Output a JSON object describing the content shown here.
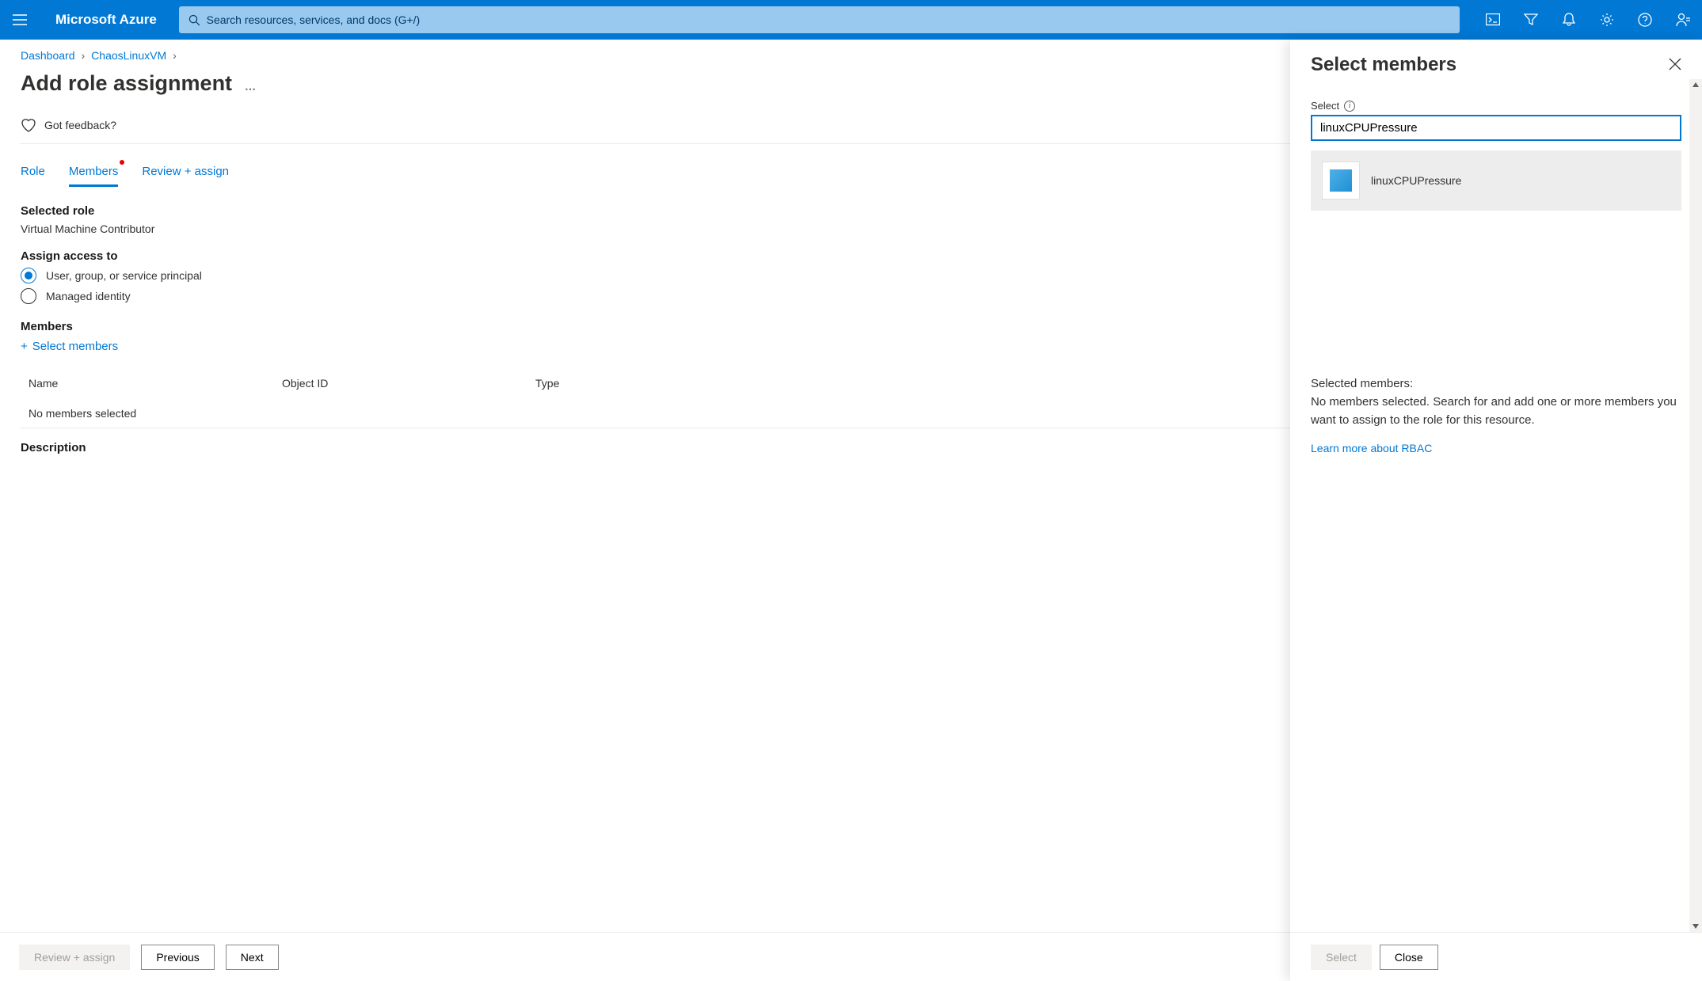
{
  "brand": "Microsoft Azure",
  "search_placeholder": "Search resources, services, and docs (G+/)",
  "breadcrumb": {
    "item0": "Dashboard",
    "item1": "ChaosLinuxVM"
  },
  "page_title": "Add role assignment",
  "feedback": "Got feedback?",
  "tabs": {
    "role": "Role",
    "members": "Members",
    "review": "Review + assign"
  },
  "labels": {
    "selected_role": "Selected role",
    "selected_role_value": "Virtual Machine Contributor",
    "assign_access": "Assign access to",
    "radio_user": "User, group, or service principal",
    "radio_managed": "Managed identity",
    "members": "Members",
    "select_members": "Select members",
    "description": "Description"
  },
  "table": {
    "col_name": "Name",
    "col_oid": "Object ID",
    "col_type": "Type",
    "empty": "No members selected"
  },
  "buttons": {
    "review_assign": "Review + assign",
    "previous": "Previous",
    "next": "Next"
  },
  "panel": {
    "title": "Select members",
    "field_label": "Select",
    "search_value": "linuxCPUPressure",
    "result_name": "linuxCPUPressure",
    "selected_hd": "Selected members:",
    "selected_bd": "No members selected. Search for and add one or more members you want to assign to the role for this resource.",
    "learn_link": "Learn more about RBAC",
    "btn_select": "Select",
    "btn_close": "Close"
  }
}
